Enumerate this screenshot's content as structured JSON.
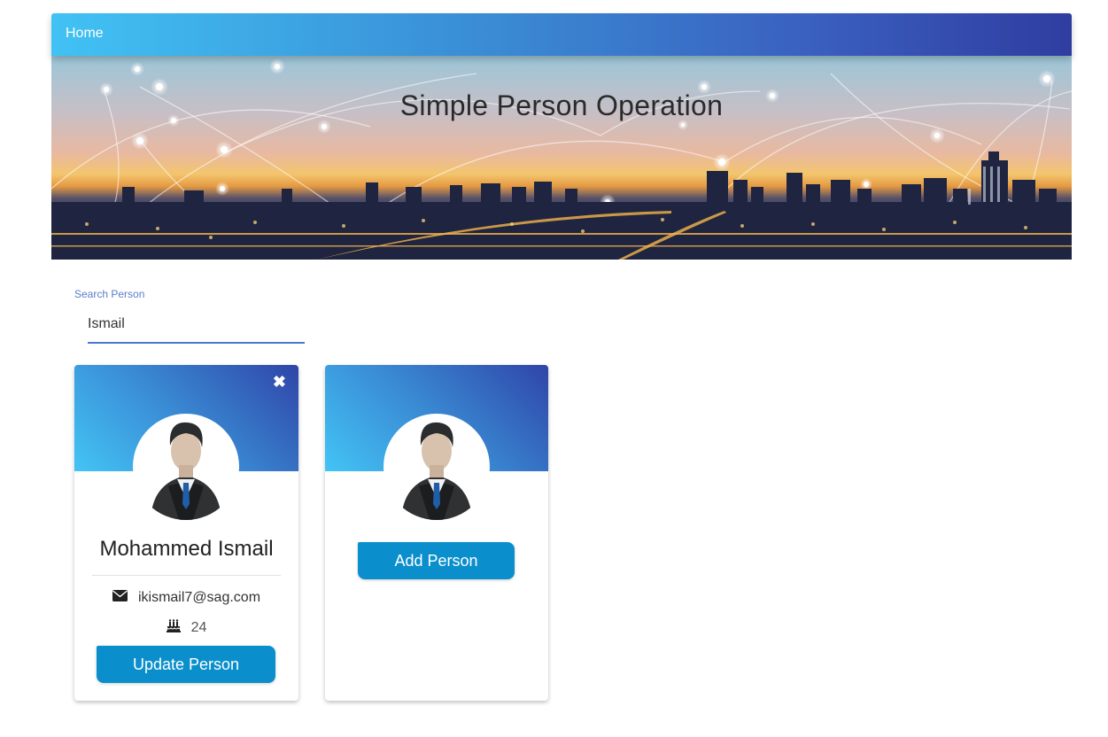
{
  "nav": {
    "home_label": "Home"
  },
  "banner": {
    "title": "Simple Person Operation"
  },
  "search": {
    "label": "Search Person",
    "value": "Ismail"
  },
  "cards": [
    {
      "name": "Mohammed Ismail",
      "email": "ikismail7@sag.com",
      "age": "24",
      "button_label": "Update Person",
      "close_icon": "close-icon",
      "email_icon": "envelope-icon",
      "age_icon": "birthday-cake-icon"
    },
    {
      "button_label": "Add Person"
    }
  ],
  "colors": {
    "accent": "#0a8fcc",
    "nav_start": "#41c2f4",
    "nav_end": "#2f3da0",
    "search_label": "#5a7ccc"
  }
}
